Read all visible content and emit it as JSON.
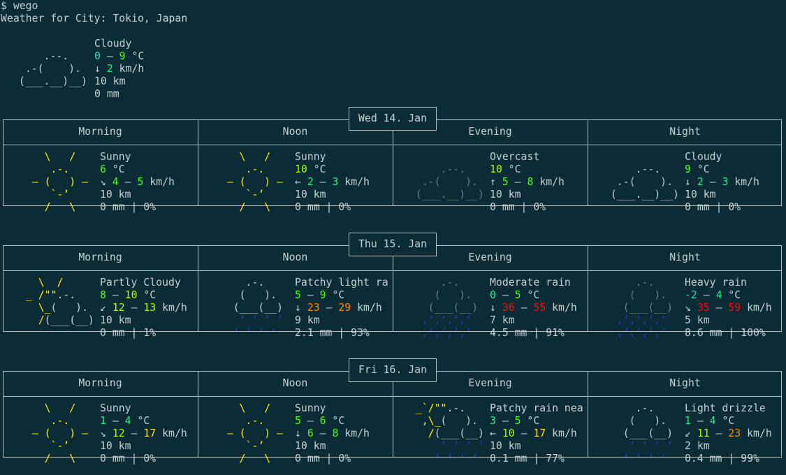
{
  "terminal": {
    "command": "$ wego",
    "heading": "Weather for City: Tokio, Japan"
  },
  "current": {
    "condition": "Cloudy",
    "temp_low": "0",
    "temp_sep": " – ",
    "temp_high": "9",
    "temp_unit": " °C",
    "wind_dir": "↓",
    "wind_speed": "2",
    "wind_unit": " km/h",
    "visibility": "10 km",
    "precip": "0 mm"
  },
  "days": [
    {
      "date": "Wed 14. Jan",
      "slots": [
        {
          "period": "Morning",
          "condition": "Sunny",
          "art": "sunny",
          "t1": "6",
          "t2": "",
          "wind_dir": "↘",
          "w1": "4",
          "w2": "5",
          "visibility": "10 km",
          "precip": "0 mm | 0%"
        },
        {
          "period": "Noon",
          "condition": "Sunny",
          "art": "sunny",
          "t1": "10",
          "t2": "",
          "wind_dir": "←",
          "w1": "2",
          "w2": "3",
          "visibility": "10 km",
          "precip": "0 mm | 0%"
        },
        {
          "period": "Evening",
          "condition": "Overcast",
          "art": "overcast",
          "t1": "10",
          "t2": "",
          "wind_dir": "↑",
          "w1": "5",
          "w2": "8",
          "visibility": "10 km",
          "precip": "0 mm | 0%"
        },
        {
          "period": "Night",
          "condition": "Cloudy",
          "art": "cloudy",
          "t1": "9",
          "t2": "",
          "wind_dir": "↓",
          "w1": "2",
          "w2": "3",
          "visibility": "10 km",
          "precip": "0 mm | 0%"
        }
      ]
    },
    {
      "date": "Thu 15. Jan",
      "slots": [
        {
          "period": "Morning",
          "condition": "Partly Cloudy",
          "art": "partly",
          "t1": "8",
          "t2": "10",
          "wind_dir": "↙",
          "w1": "12",
          "w2": "13",
          "visibility": "10 km",
          "precip": "0 mm | 1%"
        },
        {
          "period": "Noon",
          "condition": "Patchy light ra",
          "art": "lightrain",
          "t1": "5",
          "t2": "9",
          "wind_dir": "↓",
          "w1": "23",
          "w2": "29",
          "visibility": "9 km",
          "precip": "2.1 mm | 93%"
        },
        {
          "period": "Evening",
          "condition": "Moderate rain",
          "art": "heavyrain",
          "t1": "0",
          "t2": "5",
          "wind_dir": "↓",
          "w1": "36",
          "w2": "55",
          "visibility": "7 km",
          "precip": "4.5 mm | 91%"
        },
        {
          "period": "Night",
          "condition": "Heavy rain",
          "art": "heavyrain",
          "t1": "-2",
          "t2": "4",
          "wind_dir": "↘",
          "w1": "35",
          "w2": "59",
          "visibility": "5 km",
          "precip": "8.6 mm | 100%"
        }
      ]
    },
    {
      "date": "Fri 16. Jan",
      "slots": [
        {
          "period": "Morning",
          "condition": "Sunny",
          "art": "sunny",
          "t1": "1",
          "t2": "4",
          "wind_dir": "↘",
          "w1": "12",
          "w2": "17",
          "visibility": "10 km",
          "precip": "0 mm | 0%"
        },
        {
          "period": "Noon",
          "condition": "Sunny",
          "art": "sunny",
          "t1": "5",
          "t2": "6",
          "wind_dir": "↓",
          "w1": "6",
          "w2": "8",
          "visibility": "10 km",
          "precip": "0 mm | 0%"
        },
        {
          "period": "Evening",
          "condition": "Patchy rain nea",
          "art": "partlyrain",
          "t1": "3",
          "t2": "5",
          "wind_dir": "←",
          "w1": "10",
          "w2": "17",
          "visibility": "10 km",
          "precip": "0.1 mm | 77%"
        },
        {
          "period": "Night",
          "condition": "Light drizzle",
          "art": "lightrain",
          "t1": "1",
          "t2": "4",
          "wind_dir": "↙",
          "w1": "11",
          "w2": "23",
          "visibility": "2 km",
          "precip": "0.4 mm | 99%"
        }
      ]
    }
  ],
  "colors": {
    "background": "#0b2b36",
    "text": "#c6d0d3",
    "sun": "#ffea00",
    "rain": "#1f3cc8",
    "overcast": "#6f7d82"
  }
}
